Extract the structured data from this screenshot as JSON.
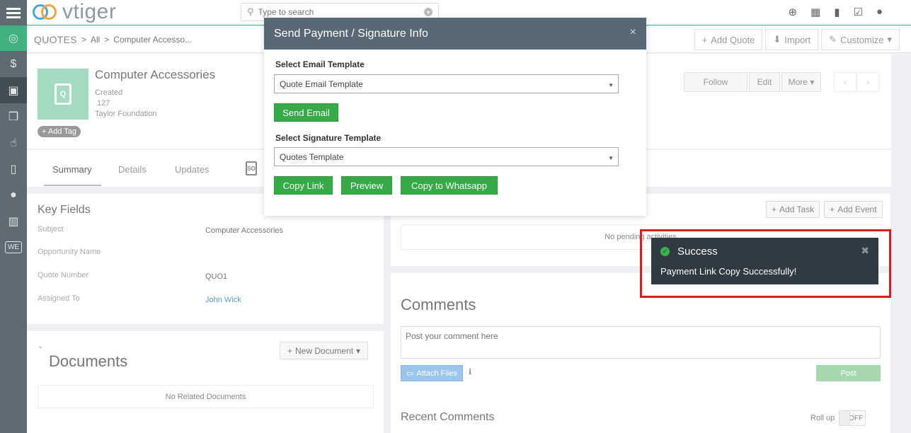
{
  "app": {
    "logo_text": "vtiger"
  },
  "topbar": {
    "search_placeholder": "Type to search"
  },
  "breadcrumb": {
    "module": "QUOTES",
    "separator": ">",
    "filter": "All",
    "record": "Computer Accesso..."
  },
  "crumb_actions": {
    "add_quote": "Add Quote",
    "import": "Import",
    "customize": "Customize"
  },
  "record": {
    "title": "Computer Accessories",
    "created_label": "Created",
    "created_value": "127",
    "organization": "Taylor Foundation",
    "add_tag": "Add Tag",
    "follow": "Follow",
    "edit": "Edit",
    "more": "More"
  },
  "tabs": [
    {
      "label": "Summary"
    },
    {
      "label": "Details"
    },
    {
      "label": "Updates"
    }
  ],
  "so_icon_text": "SO",
  "key_fields": {
    "heading": "Key Fields",
    "rows": [
      {
        "label": "Subject",
        "value": "Computer Accessories"
      },
      {
        "label": "Opportunity Name",
        "value": ""
      },
      {
        "label": "Quote Number",
        "value": "QUO1"
      },
      {
        "label": "Assigned To",
        "value": "John Wick"
      }
    ]
  },
  "documents": {
    "heading": "Documents",
    "new_button": "New Document",
    "empty": "No Related Documents"
  },
  "activities": {
    "add_task": "Add Task",
    "add_event": "Add Event",
    "empty": "No pending activities"
  },
  "comments": {
    "heading": "Comments",
    "placeholder": "Post your comment here",
    "attach": "Attach Files",
    "post": "Post",
    "recent": "Recent Comments",
    "rollup": "Roll up",
    "toggle": "OFF"
  },
  "modal": {
    "title": "Send Payment / Signature Info",
    "email_label": "Select Email Template",
    "email_value": "Quote Email Template",
    "send_email": "Send Email",
    "sig_label": "Select Signature Template",
    "sig_value": "Quotes Template",
    "copy_link": "Copy Link",
    "preview": "Preview",
    "copy_whatsapp": "Copy to Whatsapp"
  },
  "toast": {
    "title": "Success",
    "message": "Payment Link Copy Successfully!"
  },
  "colors": {
    "accent": "#3fb27f",
    "sidebar": "#5e6b73",
    "modal_header": "#596875",
    "button_green": "#35aa47",
    "toast_bg": "#2f3a43",
    "highlight": "#e01b1b"
  }
}
